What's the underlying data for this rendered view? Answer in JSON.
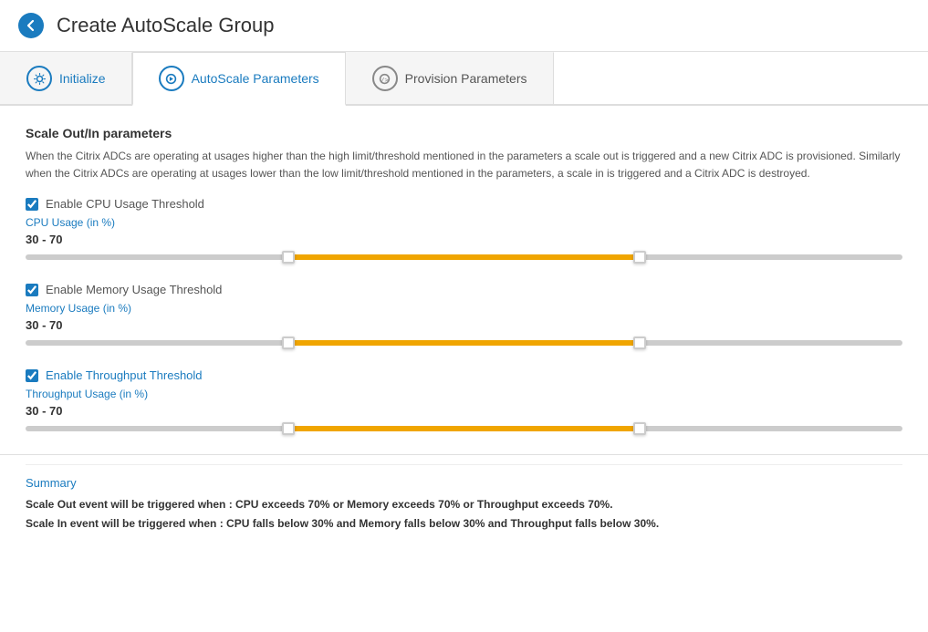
{
  "header": {
    "title": "Create AutoScale Group",
    "back_label": "back"
  },
  "tabs": [
    {
      "id": "initialize",
      "label": "Initialize",
      "icon": "gear",
      "state": "completed"
    },
    {
      "id": "autoscale-parameters",
      "label": "AutoScale Parameters",
      "icon": "play",
      "state": "active"
    },
    {
      "id": "provision-parameters",
      "label": "Provision Parameters",
      "icon": "code",
      "state": "inactive"
    }
  ],
  "content": {
    "section_title": "Scale Out/In parameters",
    "description": "When the Citrix ADCs are operating at usages higher than the high limit/threshold mentioned in the parameters a scale out is triggered and a new Citrix ADC is provisioned. Similarly when the Citrix ADCs are operating at usages lower than the low limit/threshold mentioned in the parameters, a scale in is triggered and a Citrix ADC is destroyed.",
    "thresholds": [
      {
        "id": "cpu",
        "checkbox_label": "Enable CPU Usage Threshold",
        "usage_label": "CPU Usage (in %)",
        "value_label": "30 - 70",
        "low": 30,
        "high": 70,
        "enabled": true
      },
      {
        "id": "memory",
        "checkbox_label": "Enable Memory Usage Threshold",
        "usage_label": "Memory Usage (in %)",
        "value_label": "30 - 70",
        "low": 30,
        "high": 70,
        "enabled": true
      },
      {
        "id": "throughput",
        "checkbox_label": "Enable Throughput Threshold",
        "usage_label": "Throughput Usage (in %)",
        "value_label": "30 - 70",
        "low": 30,
        "high": 70,
        "enabled": true
      }
    ],
    "summary": {
      "title": "Summary",
      "scale_out": "Scale Out event will be triggered when : CPU exceeds 70% or Memory exceeds 70% or Throughput exceeds 70%.",
      "scale_in": "Scale In event will be triggered when : CPU falls below 30% and Memory falls below 30% and Throughput falls below 30%."
    }
  }
}
